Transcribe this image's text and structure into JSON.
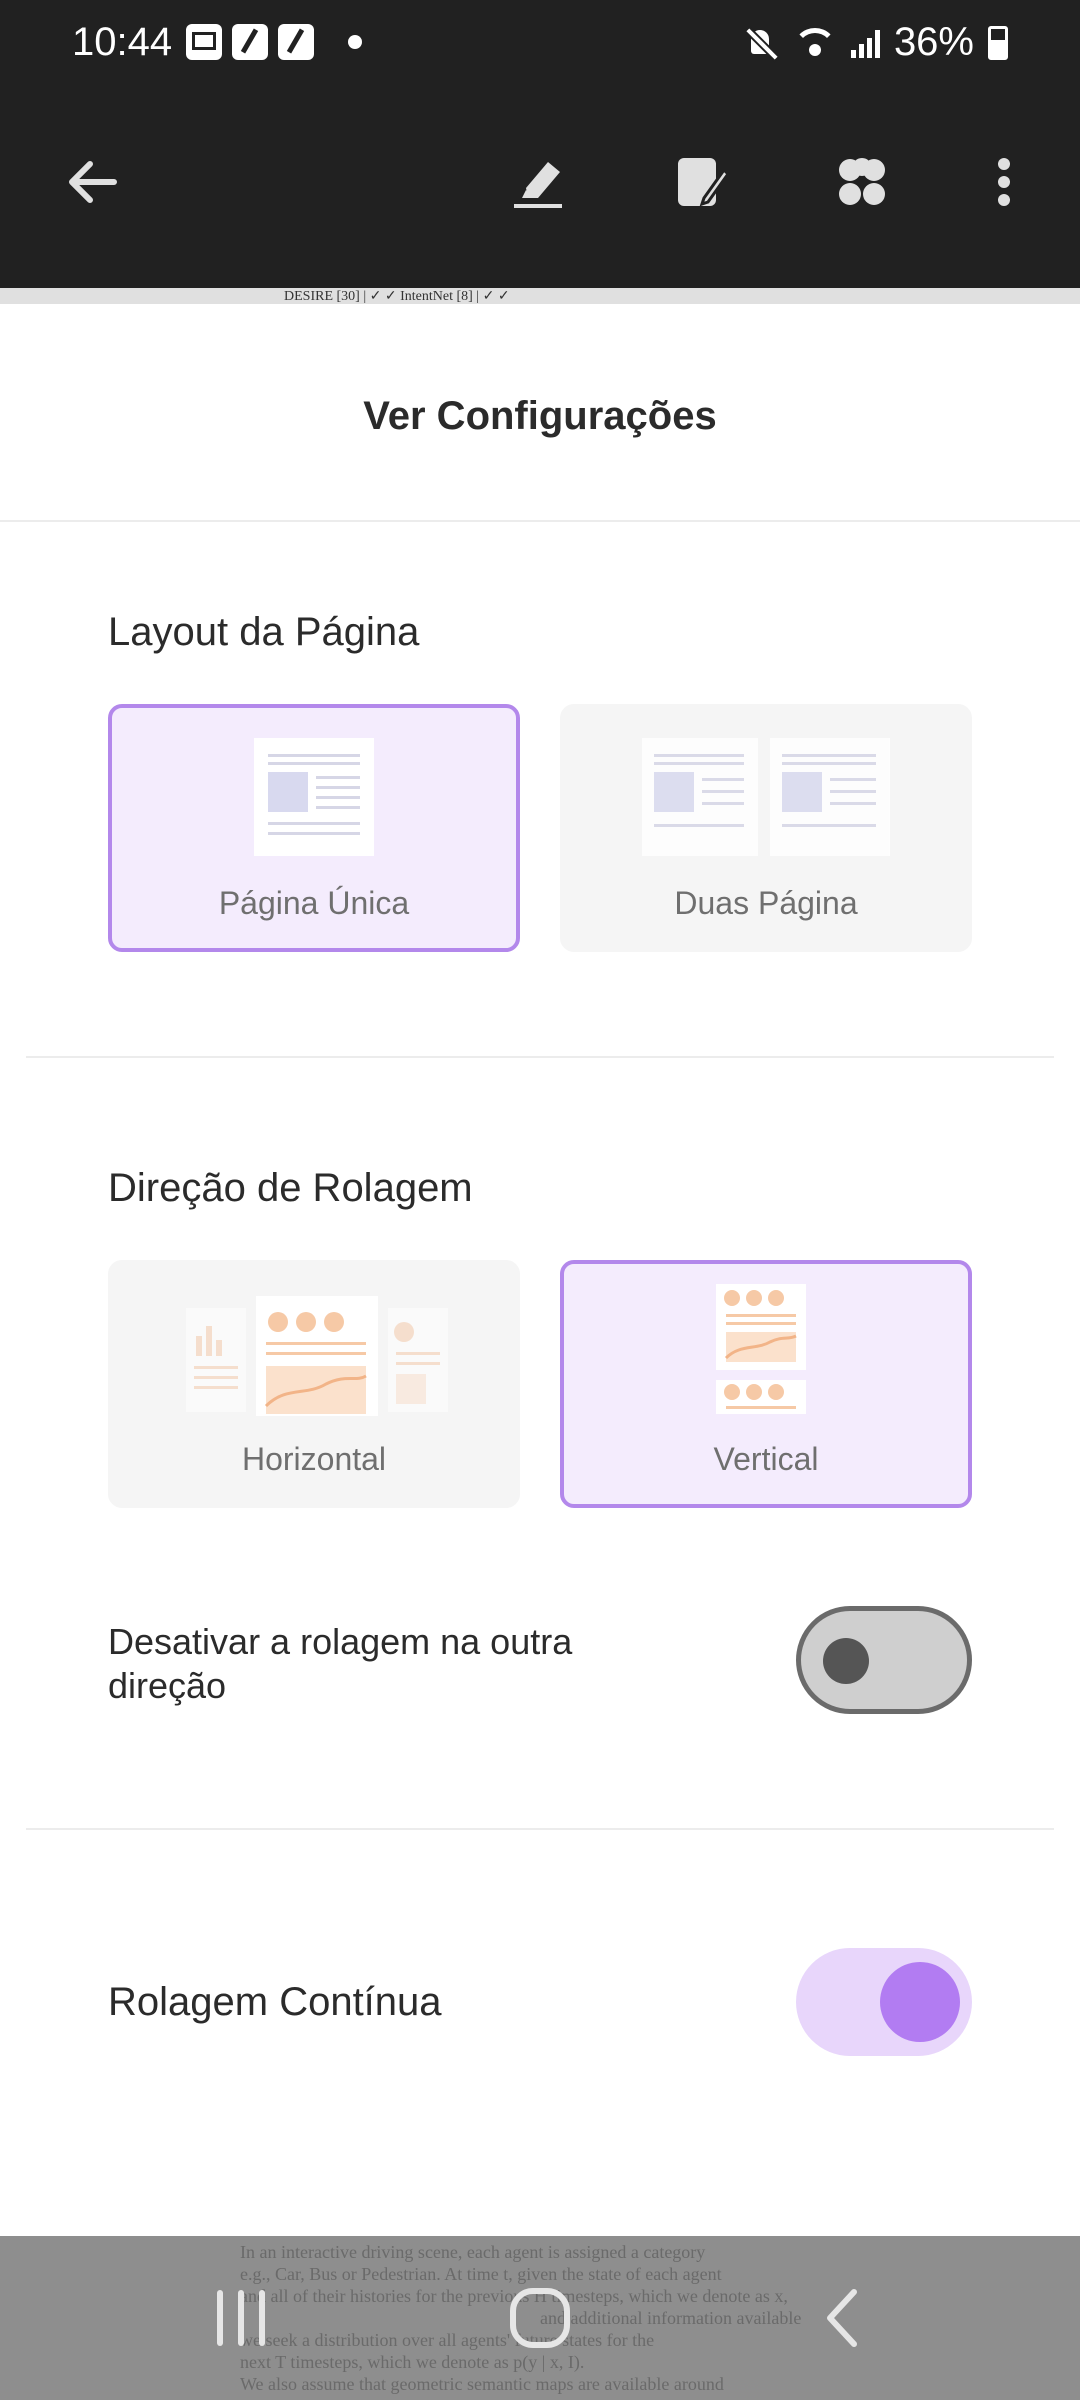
{
  "status_bar": {
    "time": "10:44",
    "battery": "36%",
    "icons": [
      "image-icon",
      "pen-note-icon",
      "pen-note-icon",
      "dot-icon",
      "mute-icon",
      "wifi-icon",
      "signal-icon",
      "battery-icon"
    ]
  },
  "toolbar": {
    "icons": [
      "back-arrow-icon",
      "highlighter-icon",
      "edit-page-icon",
      "apps-icon",
      "more-vert-icon"
    ]
  },
  "doc_peek": {
    "line": "DESIRE [30] | ✓ ✓ IntentNet [8] | ✓ ✓"
  },
  "sheet": {
    "title": "Ver Configurações",
    "page_layout": {
      "label": "Layout da Página",
      "options": [
        {
          "label": "Página Única",
          "selected": true
        },
        {
          "label": "Duas Página",
          "selected": false
        }
      ]
    },
    "scroll_direction": {
      "label": "Direção de Rolagem",
      "options": [
        {
          "label": "Horizontal",
          "selected": false
        },
        {
          "label": "Vertical",
          "selected": true
        }
      ]
    },
    "disable_other_direction": {
      "label": "Desativar a rolagem na outra direção",
      "enabled": false
    },
    "continuous_scroll": {
      "label": "Rolagem Contínua",
      "enabled": true
    }
  },
  "background_doc": {
    "lines": [
      "In an interactive driving scene, each agent is assigned a category",
      "e.g., Car, Bus or Pedestrian. At time t, given the state of each agent",
      "and all of their histories for the previous H timesteps, which we denote as x,",
      "and additional information available",
      "we seek a distribution over all agents' future states for the",
      "next T timesteps, which we denote as p(y | x, I).",
      "We also assume that geometric semantic maps are available around"
    ]
  },
  "nav_bar": {
    "icons": [
      "recent-apps-icon",
      "home-icon",
      "back-icon"
    ]
  },
  "colors": {
    "accent": "#b388eb",
    "selected_bg": "#f4ecfd",
    "toolbar_bg": "#212121"
  }
}
